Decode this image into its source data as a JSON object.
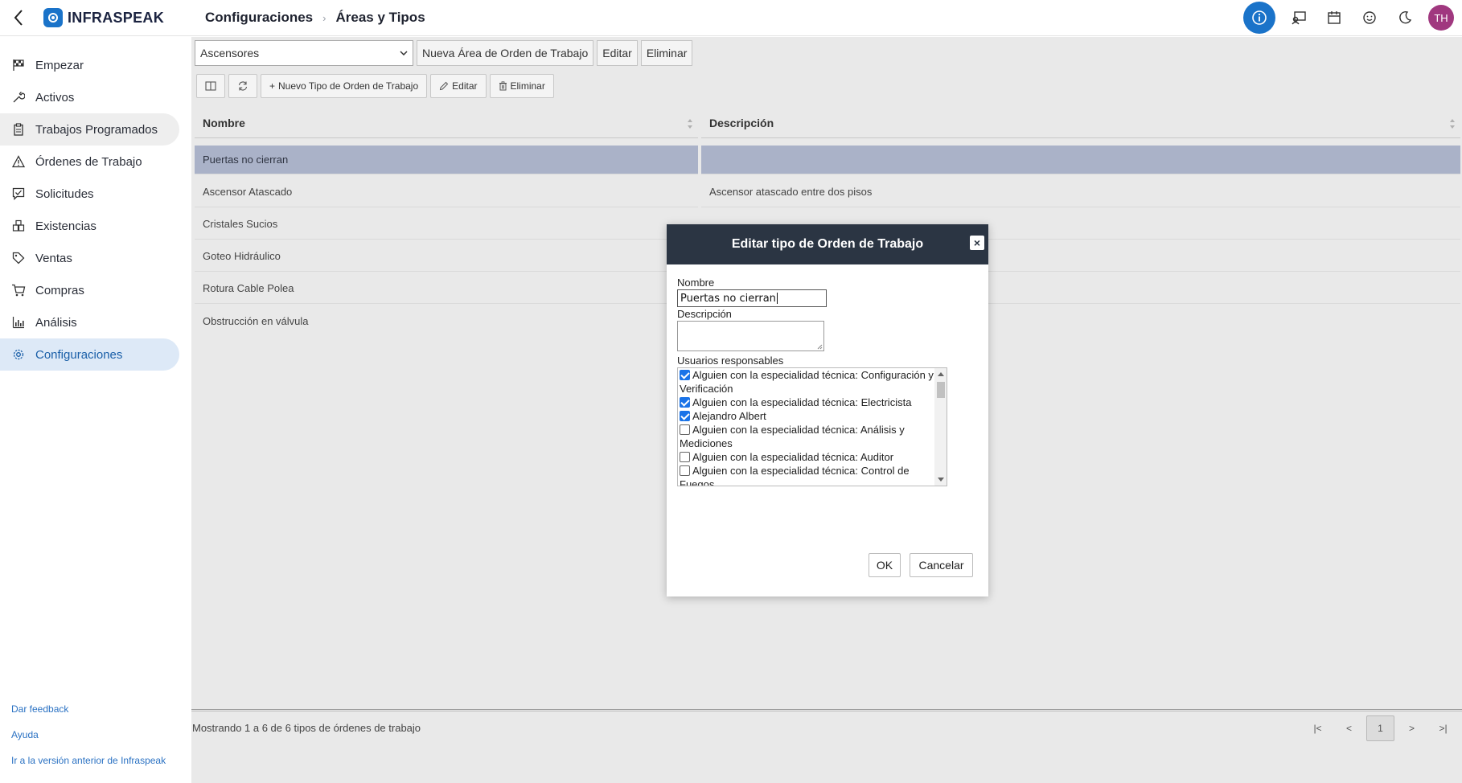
{
  "app": {
    "logo_text": "INFRASPEAK"
  },
  "breadcrumb": {
    "parent": "Configuraciones",
    "separator": "›",
    "current": "Áreas y Tipos"
  },
  "header": {
    "avatar_initials": "TH"
  },
  "sidebar": {
    "items": [
      {
        "label": "Empezar",
        "icon": "flag-icon"
      },
      {
        "label": "Activos",
        "icon": "wrench-icon"
      },
      {
        "label": "Trabajos Programados",
        "icon": "clipboard-icon"
      },
      {
        "label": "Órdenes de Trabajo",
        "icon": "warning-icon"
      },
      {
        "label": "Solicitudes",
        "icon": "message-check-icon"
      },
      {
        "label": "Existencias",
        "icon": "boxes-icon"
      },
      {
        "label": "Ventas",
        "icon": "tag-icon"
      },
      {
        "label": "Compras",
        "icon": "cart-icon"
      },
      {
        "label": "Análisis",
        "icon": "bar-chart-icon"
      },
      {
        "label": "Configuraciones",
        "icon": "gear-icon"
      }
    ],
    "links": [
      "Dar feedback",
      "Ayuda",
      "Ir a la versión anterior de Infraspeak"
    ]
  },
  "toolbar1": {
    "area_select_value": "Ascensores",
    "new_area_label": "Nueva Área de Orden de Trabajo",
    "edit_label": "Editar",
    "delete_label": "Eliminar"
  },
  "toolbar2": {
    "new_type_label": "Nuevo Tipo de Orden de Trabajo",
    "edit_label": "Editar",
    "delete_label": "Eliminar"
  },
  "table": {
    "columns": [
      "Nombre",
      "Descripción"
    ],
    "rows": [
      {
        "name": "Puertas no cierran",
        "description": ""
      },
      {
        "name": "Ascensor Atascado",
        "description": "Ascensor atascado entre dos pisos"
      },
      {
        "name": "Cristales Sucios",
        "description": ""
      },
      {
        "name": "Goteo Hidráulico",
        "description": ""
      },
      {
        "name": "Rotura Cable Polea",
        "description": ""
      },
      {
        "name": "Obstrucción en válvula",
        "description": ""
      }
    ]
  },
  "footer": {
    "summary": "Mostrando 1 a 6 de 6 tipos de órdenes de trabajo",
    "pager": {
      "first": "|<",
      "prev": "<",
      "page": "1",
      "next": ">",
      "last": ">|"
    }
  },
  "modal": {
    "title": "Editar tipo de Orden de Trabajo",
    "close_glyph": "×",
    "name_label": "Nombre",
    "name_value": "Puertas no cierran",
    "description_label": "Descripción",
    "users_label": "Usuarios responsables",
    "users": [
      {
        "label": "Alguien con la especialidad técnica: Configuración y Verificación",
        "checked": true
      },
      {
        "label": "Alguien con la especialidad técnica: Electricista",
        "checked": true
      },
      {
        "label": "Alejandro Albert",
        "checked": true
      },
      {
        "label": "Alguien con la especialidad técnica: Análisis y Mediciones",
        "checked": false
      },
      {
        "label": "Alguien con la especialidad técnica: Auditor",
        "checked": false
      },
      {
        "label": "Alguien con la especialidad técnica: Control de Fuegos",
        "checked": false
      }
    ],
    "ok_label": "OK",
    "cancel_label": "Cancelar"
  },
  "colors": {
    "accent": "#1a73c9",
    "modal_header": "#2b3543",
    "selected_row": "#aab2c8",
    "active_nav": "#dde9f7"
  }
}
